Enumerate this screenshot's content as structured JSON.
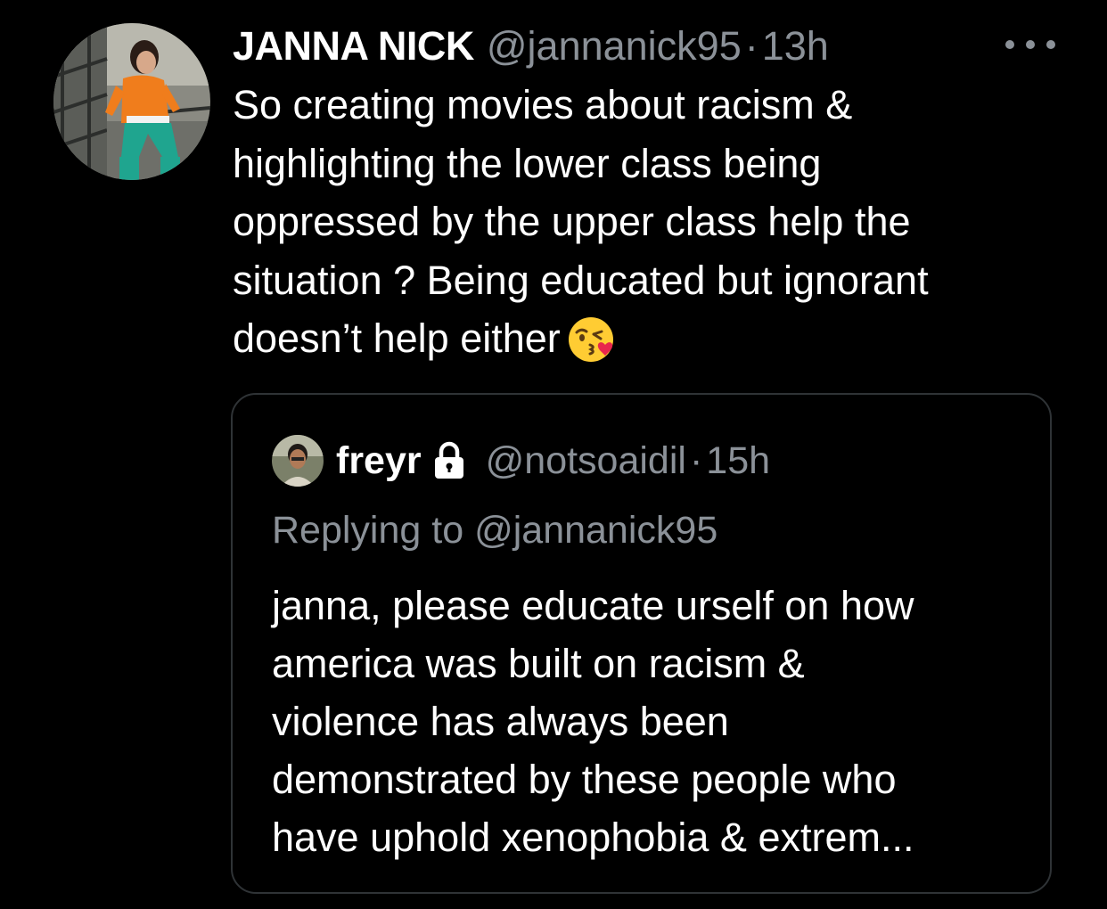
{
  "tweet": {
    "display_name": "JANNA NICK",
    "handle": "@jannanick95",
    "separator": "·",
    "time": "13h",
    "more_icon": "more-horizontal-icon",
    "text_lines": [
      "So creating movies about racism &",
      "highlighting the lower class being",
      "oppressed by the upper class help the",
      "situation ? Being educated but ignorant",
      "doesn’t help either"
    ],
    "emoji": "face-blowing-a-kiss-emoji"
  },
  "quoted": {
    "display_name": "freyr",
    "protected_icon": "lock-icon",
    "handle": "@notsoaidil",
    "separator": "·",
    "time": "15h",
    "replying_to": "Replying to @jannanick95",
    "text_lines": [
      "janna, please educate urself on how",
      "america was built on racism &",
      "violence has always been",
      "demonstrated by these people who",
      "have uphold xenophobia & extrem..."
    ]
  },
  "colors": {
    "background": "#000000",
    "primary_text": "#ffffff",
    "secondary_text": "#8b9198",
    "border": "#2f3336"
  }
}
